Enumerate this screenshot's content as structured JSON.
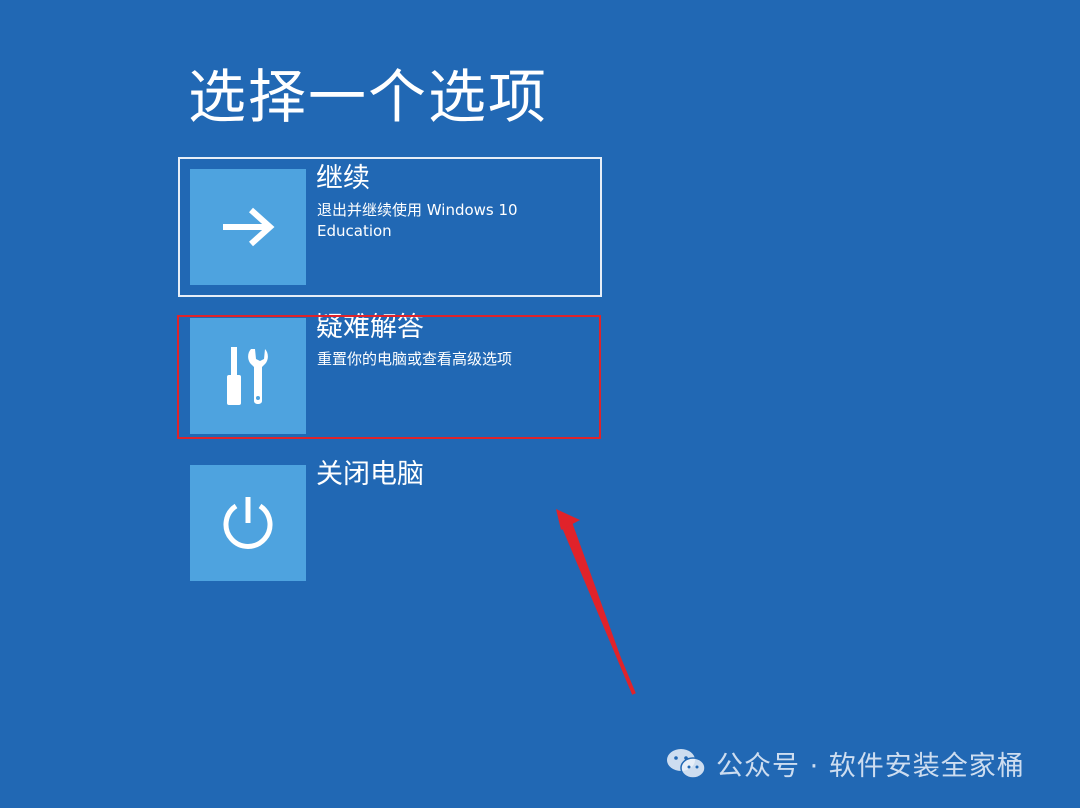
{
  "page": {
    "title": "选择一个选项"
  },
  "options": [
    {
      "icon": "arrow-right-icon",
      "title": "继续",
      "description": "退出并继续使用 Windows 10 Education",
      "selected": true
    },
    {
      "icon": "tools-icon",
      "title": "疑难解答",
      "description": "重置你的电脑或查看高级选项",
      "highlighted": true
    },
    {
      "icon": "power-icon",
      "title": "关闭电脑"
    }
  ],
  "annotation": {
    "highlight_color": "#e0232a",
    "arrow_color": "#e0232a"
  },
  "watermark": {
    "icon": "wechat-icon",
    "text": "公众号 · 软件安装全家桶"
  },
  "colors": {
    "background": "#2168b4",
    "tile": "#4ea3df",
    "text": "#ffffff"
  }
}
